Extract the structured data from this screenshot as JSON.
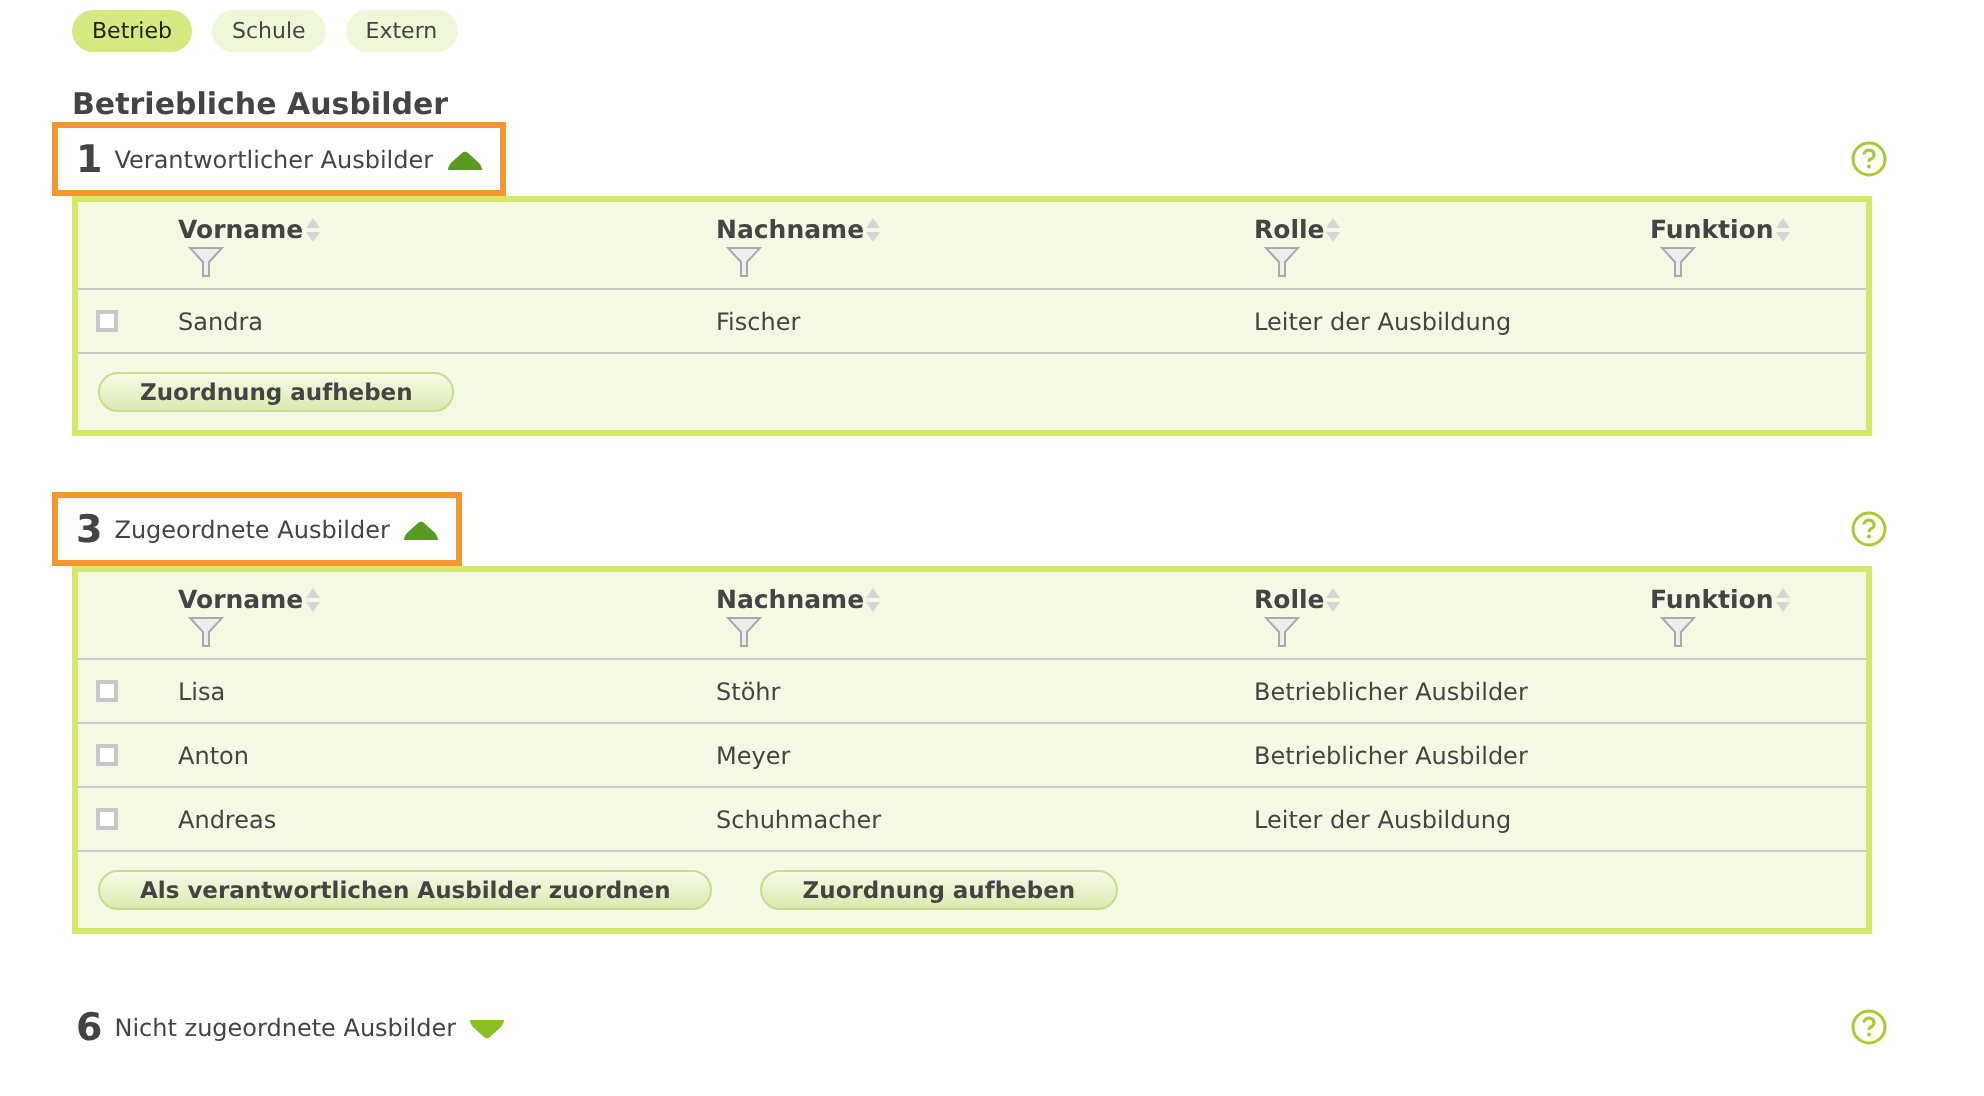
{
  "tabs": [
    {
      "label": "Betrieb",
      "selected": true
    },
    {
      "label": "Schule",
      "selected": false
    },
    {
      "label": "Extern",
      "selected": false
    }
  ],
  "heading": "Betriebliche Ausbilder",
  "sections": [
    {
      "number": "1",
      "title": "Verantwortlicher Ausbilder",
      "expanded": true,
      "highlighted": true,
      "table": {
        "columns": [
          "Vorname",
          "Nachname",
          "Rolle",
          "Funktion"
        ],
        "rows": [
          {
            "checked": false,
            "cells": [
              "Sandra",
              "Fischer",
              "Leiter der Ausbildung",
              ""
            ]
          }
        ],
        "buttons": [
          "Zuordnung aufheben"
        ]
      }
    },
    {
      "number": "3",
      "title": "Zugeordnete Ausbilder",
      "expanded": true,
      "highlighted": true,
      "table": {
        "columns": [
          "Vorname",
          "Nachname",
          "Rolle",
          "Funktion"
        ],
        "rows": [
          {
            "checked": false,
            "cells": [
              "Lisa",
              "Stöhr",
              "Betrieblicher Ausbilder",
              ""
            ]
          },
          {
            "checked": false,
            "cells": [
              "Anton",
              "Meyer",
              "Betrieblicher Ausbilder",
              ""
            ]
          },
          {
            "checked": false,
            "cells": [
              "Andreas",
              "Schuhmacher",
              "Leiter der Ausbildung",
              ""
            ]
          }
        ],
        "buttons": [
          "Als verantwortlichen Ausbilder zuordnen",
          "Zuordnung aufheben"
        ]
      }
    },
    {
      "number": "6",
      "title": "Nicht zugeordnete Ausbilder",
      "expanded": false,
      "highlighted": false
    }
  ]
}
